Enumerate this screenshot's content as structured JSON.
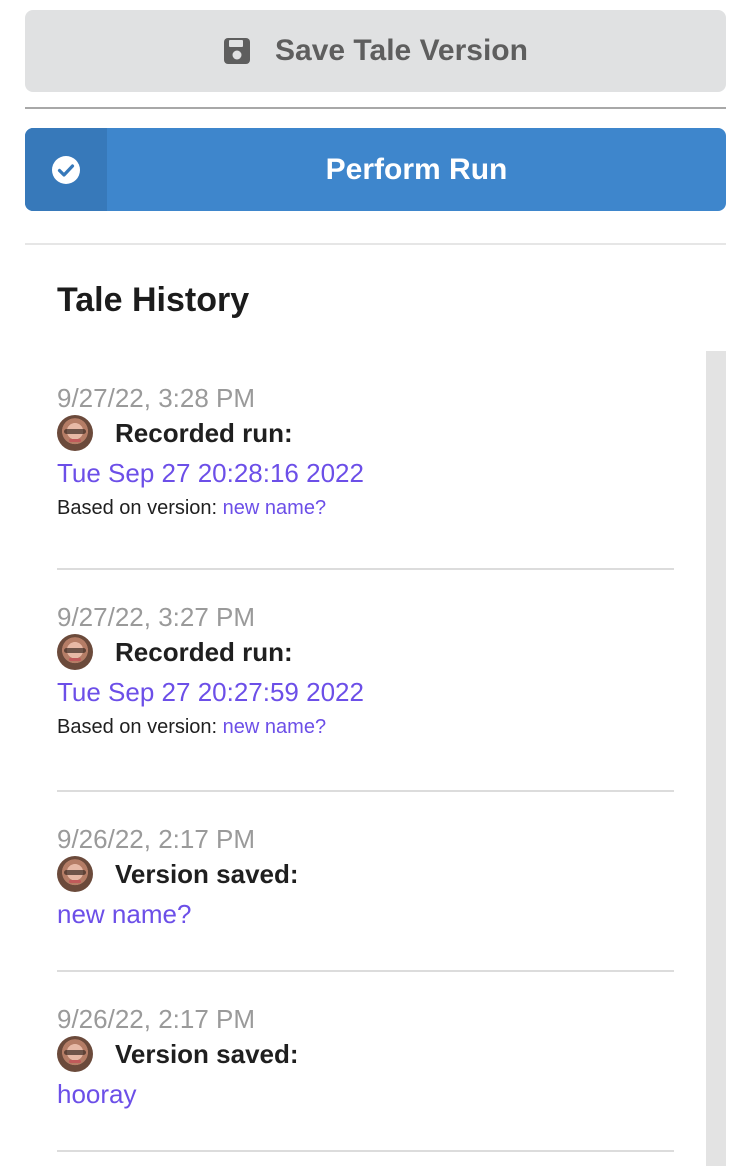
{
  "toolbar": {
    "save_label": "Save Tale Version",
    "run_label": "Perform Run"
  },
  "history": {
    "title": "Tale History",
    "entries": [
      {
        "time": "9/27/22, 3:28 PM",
        "action": "Recorded run:",
        "link": "Tue Sep 27 20:28:16 2022",
        "based_label": "Based on version:",
        "based_link": "new name?"
      },
      {
        "time": "9/27/22, 3:27 PM",
        "action": "Recorded run:",
        "link": "Tue Sep 27 20:27:59 2022",
        "based_label": "Based on version:",
        "based_link": "new name?"
      },
      {
        "time": "9/26/22, 2:17 PM",
        "action": "Version saved:",
        "link": "new name?"
      },
      {
        "time": "9/26/22, 2:17 PM",
        "action": "Version saved:",
        "link": "hooray"
      }
    ]
  },
  "colors": {
    "primary": "#3e86cc",
    "link": "#6c4fe8",
    "muted": "#9a9a9a"
  }
}
